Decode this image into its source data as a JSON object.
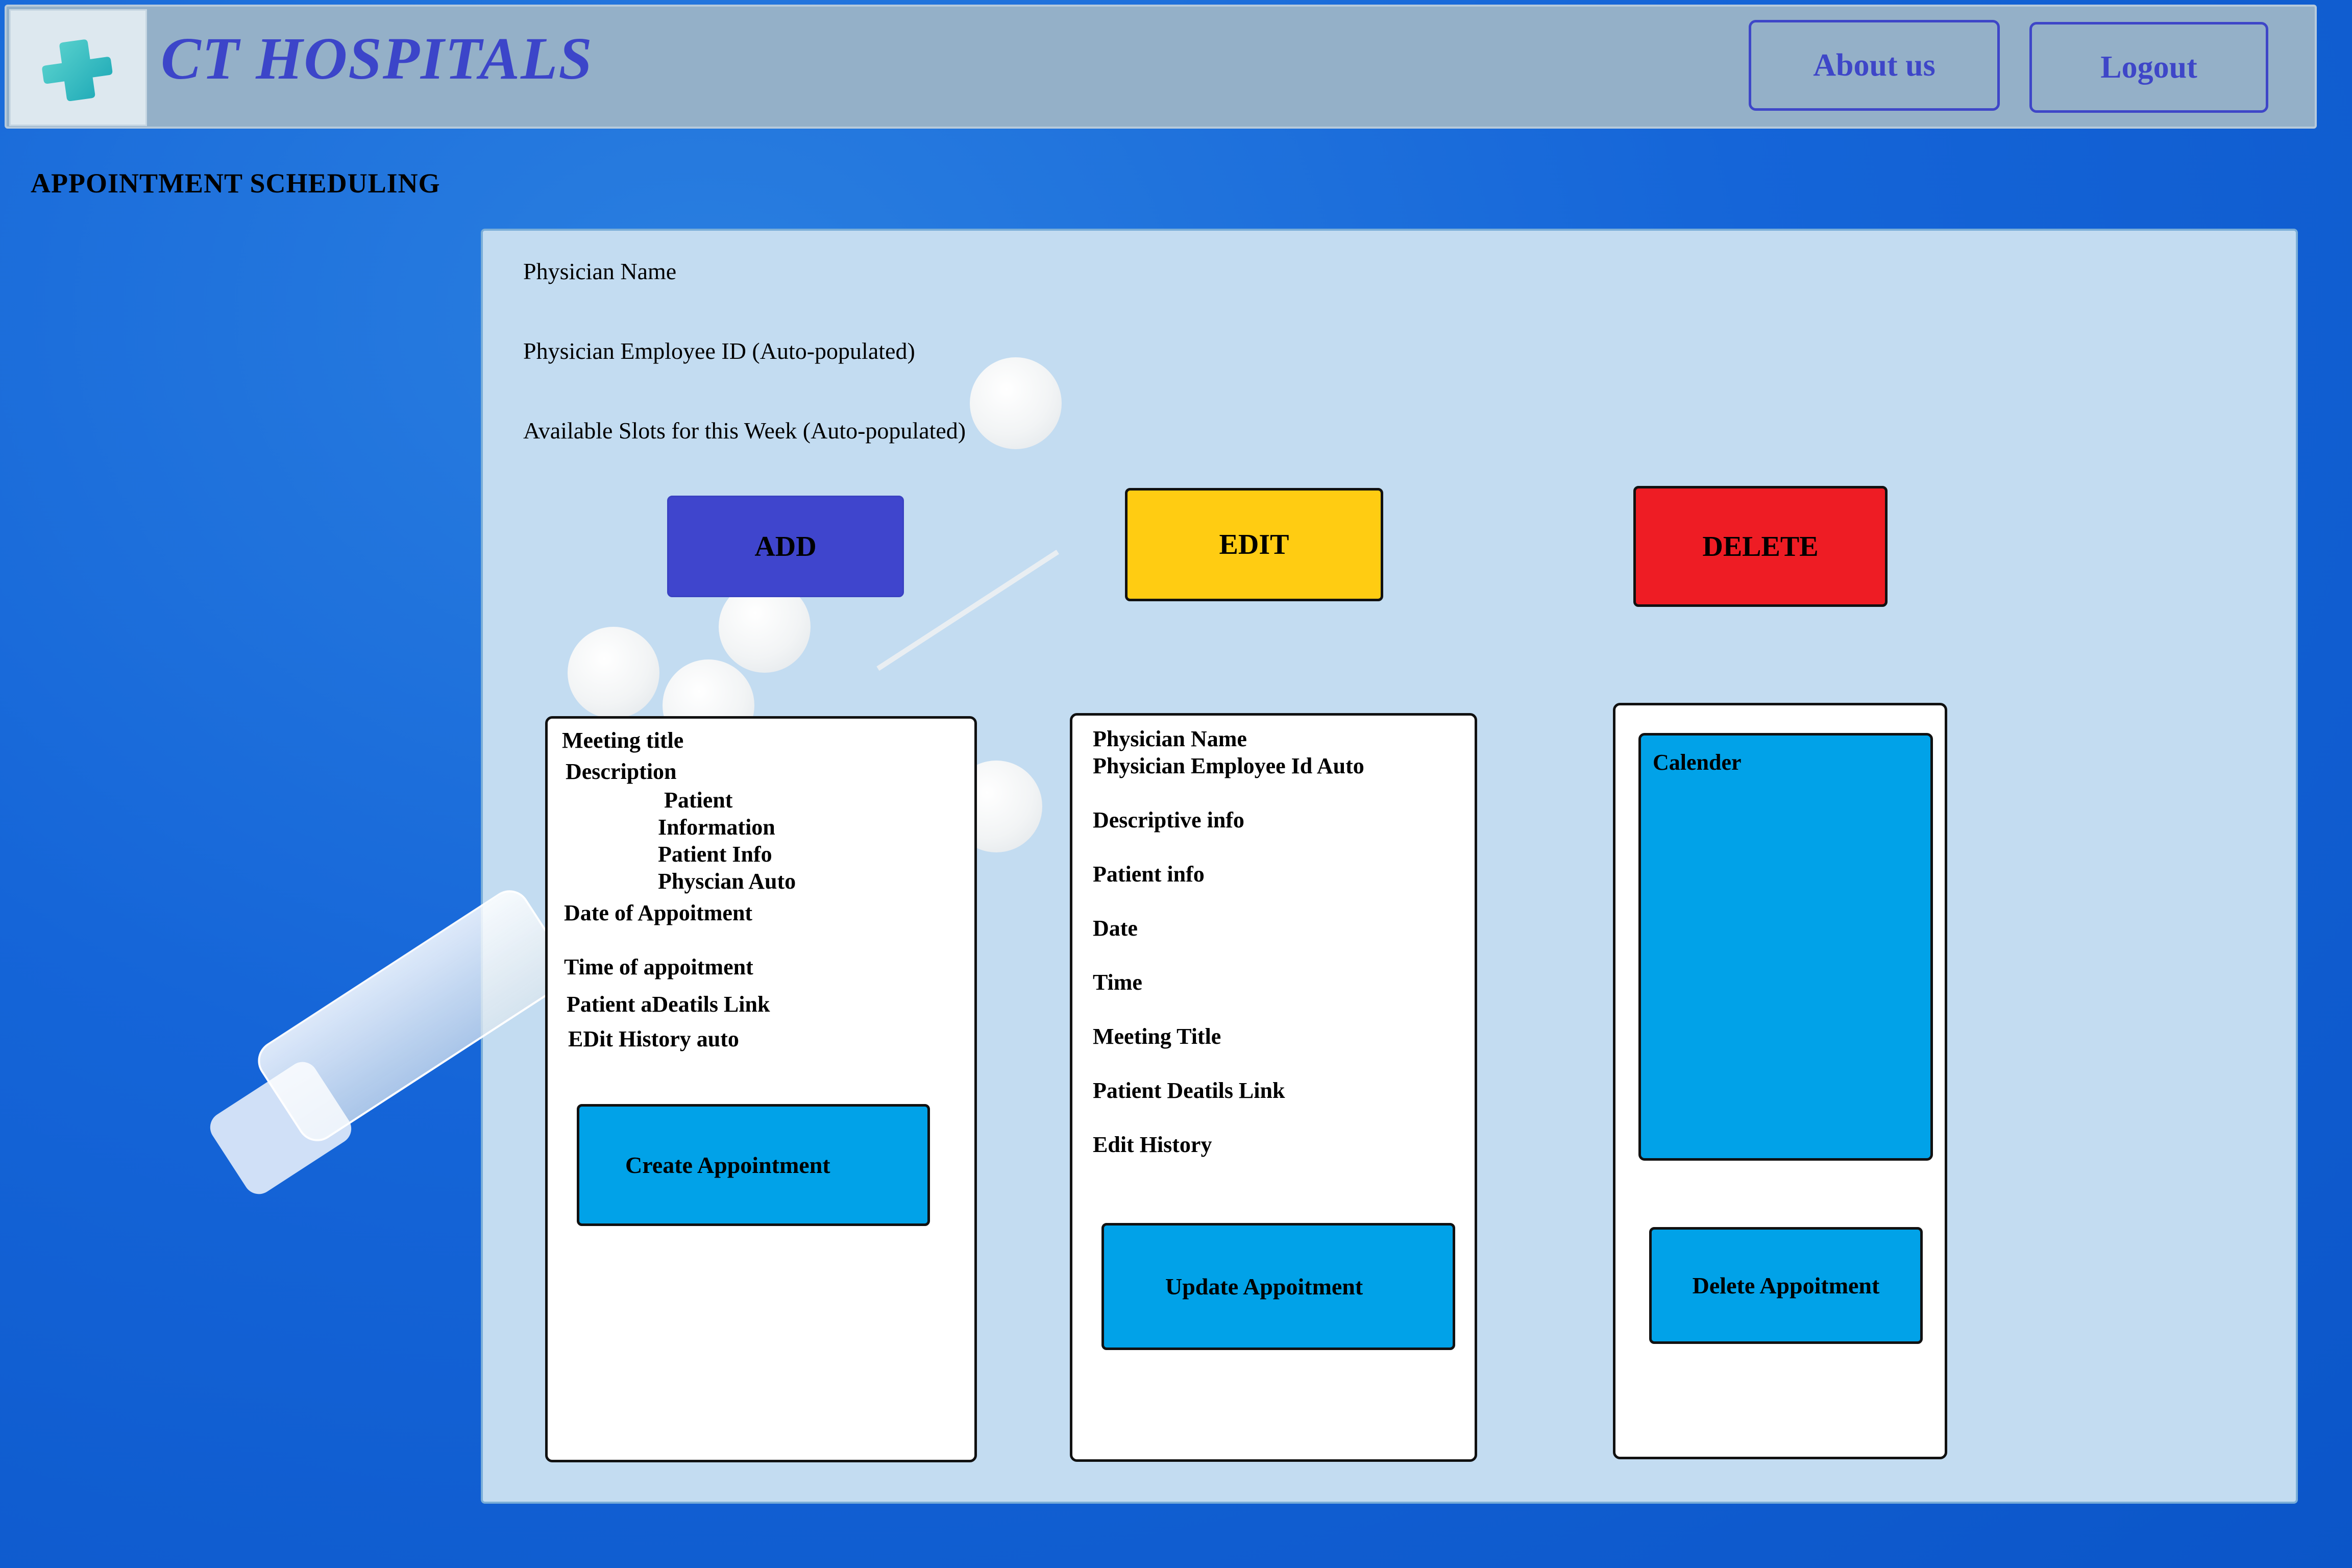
{
  "header": {
    "title": "CT HOSPITALS",
    "logo_icon": "medical-cross-icon",
    "about_label": "About us",
    "logout_label": "Logout"
  },
  "page_heading": "APPOINTMENT SCHEDULING",
  "panel": {
    "physician_name": "Physician Name",
    "physician_employee_id": "Physician Employee ID (Auto-populated)",
    "available_slots": "Available Slots for this Week (Auto-populated)"
  },
  "actions": {
    "add": "ADD",
    "edit": "EDIT",
    "delete": "DELETE"
  },
  "add_card": {
    "meeting_title": "Meeting title",
    "description": "Description",
    "patient": "Patient",
    "information": "Information",
    "patient_info": "Patient Info",
    "physician": "Physcian   Auto",
    "date": "Date of Appoitment",
    "time": "Time of appoitment",
    "patient_details": "Patient aDeatils   Link",
    "edit_history": "EDit History   auto",
    "button": "Create Appointment"
  },
  "edit_card": {
    "physician_name": "Physician Name",
    "physician_employee_id": "Physician Employee Id  Auto",
    "descriptive_info": "Descriptive info",
    "patient_info": "Patient info",
    "date": "Date",
    "time": "Time",
    "meeting_title": "Meeting Title",
    "patient_details": "Patient Deatils   Link",
    "edit_history": "Edit History",
    "button": "Update Appoitment"
  },
  "delete_card": {
    "calendar": "Calender",
    "button": "Delete Appoitment"
  },
  "colors": {
    "background": "#1565d8",
    "header": "#94b0c8",
    "accent": "#3e46c8",
    "add": "#3f45cd",
    "edit": "#ffcc12",
    "delete": "#ee1c24",
    "action_blue": "#01a2e8"
  }
}
